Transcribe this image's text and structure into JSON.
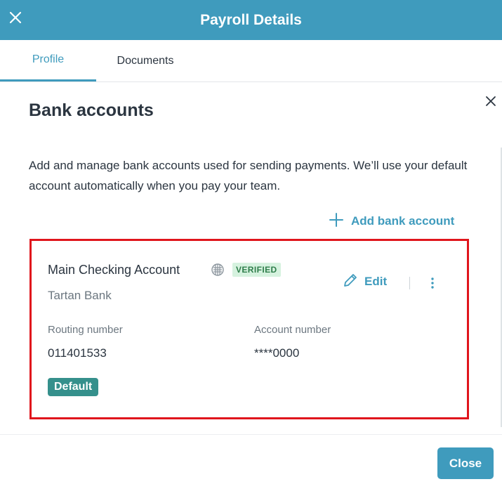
{
  "header": {
    "title": "Payroll Details",
    "close_icon": "close-icon"
  },
  "tabs": [
    {
      "label": "Profile",
      "active": true
    },
    {
      "label": "Documents",
      "active": false
    }
  ],
  "panel": {
    "title": "Bank accounts",
    "description": "Add and manage bank accounts used for sending payments. We’ll use your default account automatically when you pay your team.",
    "add_label": "Add bank account"
  },
  "account": {
    "name": "Main Checking Account",
    "status": "VERIFIED",
    "bank": "Tartan Bank",
    "edit_label": "Edit",
    "routing_label": "Routing number",
    "routing_value": "011401533",
    "account_label": "Account number",
    "account_value": "****0000",
    "default_label": "Default"
  },
  "footer": {
    "close_label": "Close"
  },
  "colors": {
    "brand": "#3f9bbd",
    "highlight_border": "#e0151c",
    "verified_bg": "#d6f2df",
    "default_badge": "#35908c"
  }
}
